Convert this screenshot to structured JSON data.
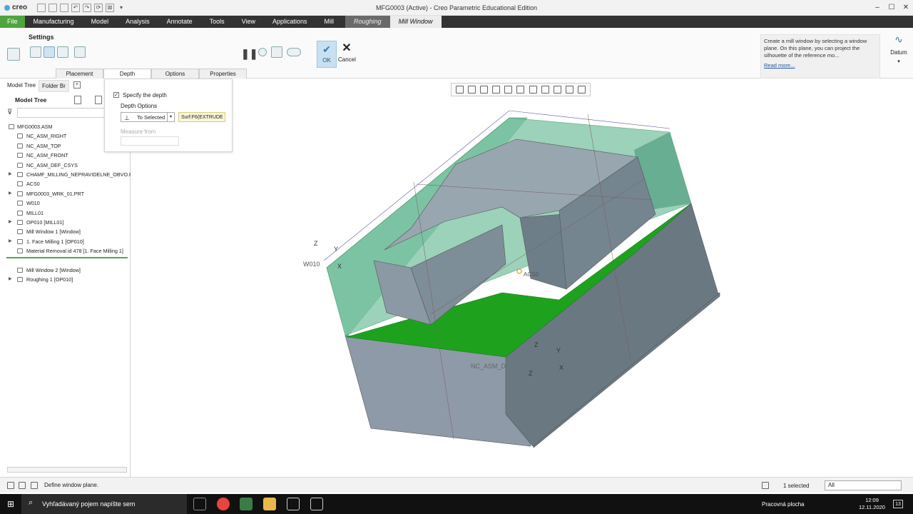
{
  "app": {
    "logo": "creo",
    "title": "MFG0003 (Active) - Creo Parametric Educational Edition"
  },
  "ribbon_tabs": [
    "File",
    "Manufacturing",
    "Model",
    "Analysis",
    "Annotate",
    "Tools",
    "View",
    "Applications",
    "Mill",
    "Roughing",
    "Mill Window"
  ],
  "ribbon": {
    "settings_label": "Settings",
    "ok_label": "OK",
    "cancel_label": "Cancel",
    "subtabs": [
      "Placement",
      "Depth",
      "Options",
      "Properties"
    ],
    "help_text": "Create a mill window by selecting a window plane. On this plane, you can project the silhouette of the reference mo...",
    "read_more": "Read more...",
    "datum_label": "Datum"
  },
  "depth_panel": {
    "specify_label": "Specify the depth",
    "depth_options_label": "Depth Options",
    "option_value": "To Selected",
    "reference_value": "Surf:F6(EXTRUDE",
    "measure_from_label": "Measure from"
  },
  "left_panel": {
    "tab_model_tree": "Model Tree",
    "tab_folder": "Folder Br",
    "header": "Model Tree",
    "items": [
      {
        "label": "MFG0003.ASM"
      },
      {
        "label": "NC_ASM_RIGHT"
      },
      {
        "label": "NC_ASM_TOP"
      },
      {
        "label": "NC_ASM_FRONT"
      },
      {
        "label": "NC_ASM_DEF_CSYS"
      },
      {
        "label": "CHAMF_MILLING_NEPRAVIDELNE_OBVO.P"
      },
      {
        "label": "ACS0"
      },
      {
        "label": "MFG0003_WRK_01.PRT"
      },
      {
        "label": "W010"
      },
      {
        "label": "MILL01"
      },
      {
        "label": "OP010 [MILL01]"
      },
      {
        "label": "Mill Window 1 [Window]"
      },
      {
        "label": "1. Face Milling 1 [OP010]"
      },
      {
        "label": "Material Removal id 478 [1. Face Milling 1]"
      },
      {
        "label": "Mill Window 2 [Window]"
      },
      {
        "label": "Roughing 1 [OP010]"
      }
    ]
  },
  "viewport_labels": {
    "w010": "W010",
    "acs0": "ACS0",
    "nc_asm": "NC_ASM_D",
    "axis_x": "X",
    "axis_y": "Y",
    "axis_z": "Z"
  },
  "statusbar": {
    "message": "Define window plane.",
    "selected": "1 selected",
    "filter": "All"
  },
  "taskbar": {
    "search_placeholder": "Vyhľadávaný pojem napíšte sem",
    "tray_label": "Pracovná plocha",
    "time": "12:09",
    "date": "12.11.2020",
    "notifications": "13"
  },
  "colors": {
    "file_tab": "#4fa43d",
    "ribbon_tab_bar": "#333333",
    "stock_green": "#2fb34f",
    "cut_face": "#1ea21e",
    "part_blue_gray": "#8e9aa7"
  }
}
